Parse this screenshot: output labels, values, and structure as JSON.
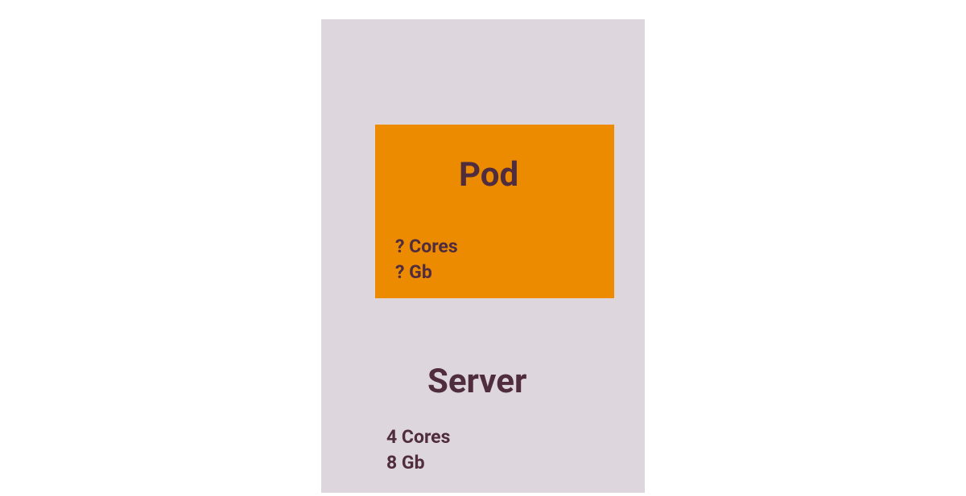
{
  "diagram": {
    "server": {
      "title": "Server",
      "cores": "4 Cores",
      "memory": "8 Gb"
    },
    "pod": {
      "title": "Pod",
      "cores": "? Cores",
      "memory": "? Gb"
    }
  }
}
